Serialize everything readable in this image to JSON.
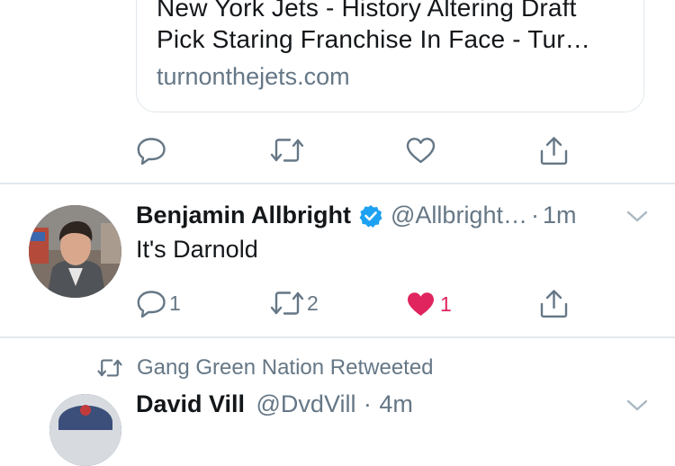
{
  "card": {
    "title_line1": "New York Jets - History Altering Draft",
    "title_line2": "Pick Staring Franchise In Face - Tur…",
    "domain": "turnonthejets.com"
  },
  "tweet1_actions": {
    "reply_icon": "reply-icon",
    "retweet_icon": "retweet-icon",
    "like_icon": "heart-outline-icon",
    "share_icon": "share-icon"
  },
  "tweet2": {
    "name": "Benjamin Allbright",
    "verified": true,
    "handle": "@Allbright…",
    "separator": "·",
    "time": "1m",
    "text": "It's Darnold",
    "reply_count": "1",
    "retweet_count": "2",
    "like_count": "1",
    "liked": true
  },
  "tweet3": {
    "retweeted_by": "Gang Green Nation Retweeted",
    "name": "David Vill",
    "handle": "@DvdVill",
    "separator": "·",
    "time": "4m"
  },
  "colors": {
    "text": "#14171a",
    "secondary": "#657786",
    "verified": "#1da1f2",
    "like": "#e0245e",
    "divider": "#e1e8ed"
  }
}
